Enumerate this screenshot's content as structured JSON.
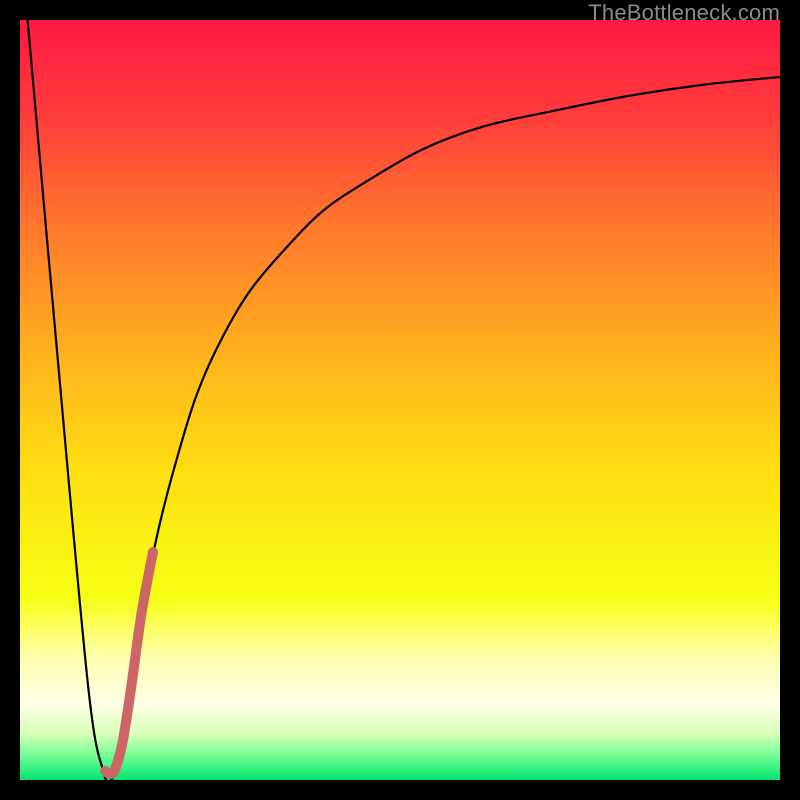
{
  "watermark": "TheBottleneck.com",
  "chart_data": {
    "type": "line",
    "title": "",
    "xlabel": "",
    "ylabel": "",
    "xlim": [
      0,
      100
    ],
    "ylim": [
      0,
      100
    ],
    "grid": false,
    "background_gradient": {
      "stops": [
        {
          "pos": 0.0,
          "color": "#ff1a43"
        },
        {
          "pos": 0.12,
          "color": "#ff3a3c"
        },
        {
          "pos": 0.28,
          "color": "#ff7a2c"
        },
        {
          "pos": 0.44,
          "color": "#ffb21e"
        },
        {
          "pos": 0.6,
          "color": "#ffe012"
        },
        {
          "pos": 0.76,
          "color": "#f6ff14"
        },
        {
          "pos": 0.84,
          "color": "#ffffb0"
        },
        {
          "pos": 0.9,
          "color": "#ffffe8"
        },
        {
          "pos": 0.94,
          "color": "#d7ffb8"
        },
        {
          "pos": 0.965,
          "color": "#7dff9a"
        },
        {
          "pos": 1.0,
          "color": "#00e66f"
        }
      ]
    },
    "series": [
      {
        "name": "bottleneck-curve",
        "color": "#000000",
        "width": 2.2,
        "x": [
          1,
          5,
          9,
          11,
          12,
          13,
          14,
          16,
          18,
          20,
          23,
          26,
          30,
          35,
          40,
          46,
          53,
          61,
          70,
          80,
          90,
          100
        ],
        "y": [
          100,
          55,
          12,
          1,
          0,
          3,
          10,
          22,
          32,
          40,
          50,
          57,
          64,
          70,
          75,
          79,
          83,
          86,
          88,
          90,
          91.5,
          92.5
        ]
      },
      {
        "name": "highlight-segment",
        "color": "#cc6666",
        "width": 10,
        "x": [
          11.2,
          11.8,
          12.5,
          13.5,
          14.6,
          16.0,
          17.5
        ],
        "y": [
          1.2,
          0.8,
          1.4,
          5.0,
          12.0,
          22.0,
          30.0
        ]
      }
    ]
  }
}
